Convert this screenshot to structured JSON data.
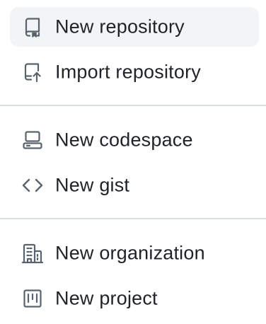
{
  "menu": {
    "items": [
      {
        "label": "New repository",
        "icon": "repo-icon"
      },
      {
        "label": "Import repository",
        "icon": "repo-push-icon"
      },
      {
        "label": "New codespace",
        "icon": "codespaces-icon"
      },
      {
        "label": "New gist",
        "icon": "code-icon"
      },
      {
        "label": "New organization",
        "icon": "organization-icon"
      },
      {
        "label": "New project",
        "icon": "project-icon"
      }
    ]
  },
  "colors": {
    "text": "#1f2328",
    "icon": "#59636e",
    "hover_bg": "#f3f4f6",
    "divider": "#d8dee4"
  }
}
